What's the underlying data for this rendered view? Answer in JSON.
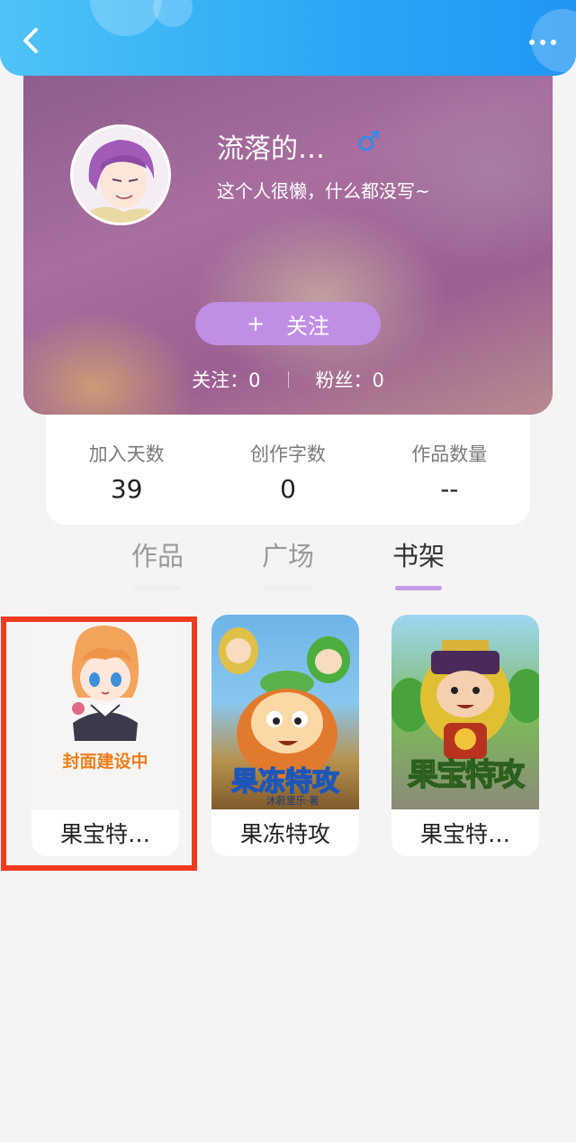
{
  "profile": {
    "username": "流落的…",
    "gender_symbol": "♂",
    "bio": "这个人很懒，什么都没写~",
    "follow_plus": "+",
    "follow_label": "关注",
    "following": "关注：0",
    "fans": "粉丝：0"
  },
  "stats": [
    {
      "label": "加入天数",
      "value": "39"
    },
    {
      "label": "创作字数",
      "value": "0"
    },
    {
      "label": "作品数量",
      "value": "--"
    }
  ],
  "tabs": [
    {
      "label": "作品"
    },
    {
      "label": "广场"
    },
    {
      "label": "书架"
    }
  ],
  "shelf": [
    {
      "title": "果宝特…",
      "cover_text": "封面建设中"
    },
    {
      "title": "果冻特攻",
      "cover_text": "果冻特攻",
      "cover_sub": "沐蔚里乐·著"
    },
    {
      "title": "果宝特…",
      "cover_text": "果宝特攻"
    }
  ],
  "colors": {
    "header": "#29a6f5",
    "follow_button": "#c18ee6",
    "active_tab_bar": "#c59be5",
    "highlight": "#f03b1f",
    "gender": "#2d8cf0"
  },
  "icons": {
    "back": "back-arrow-icon",
    "more": "more-dots-icon",
    "gender": "male-icon"
  }
}
